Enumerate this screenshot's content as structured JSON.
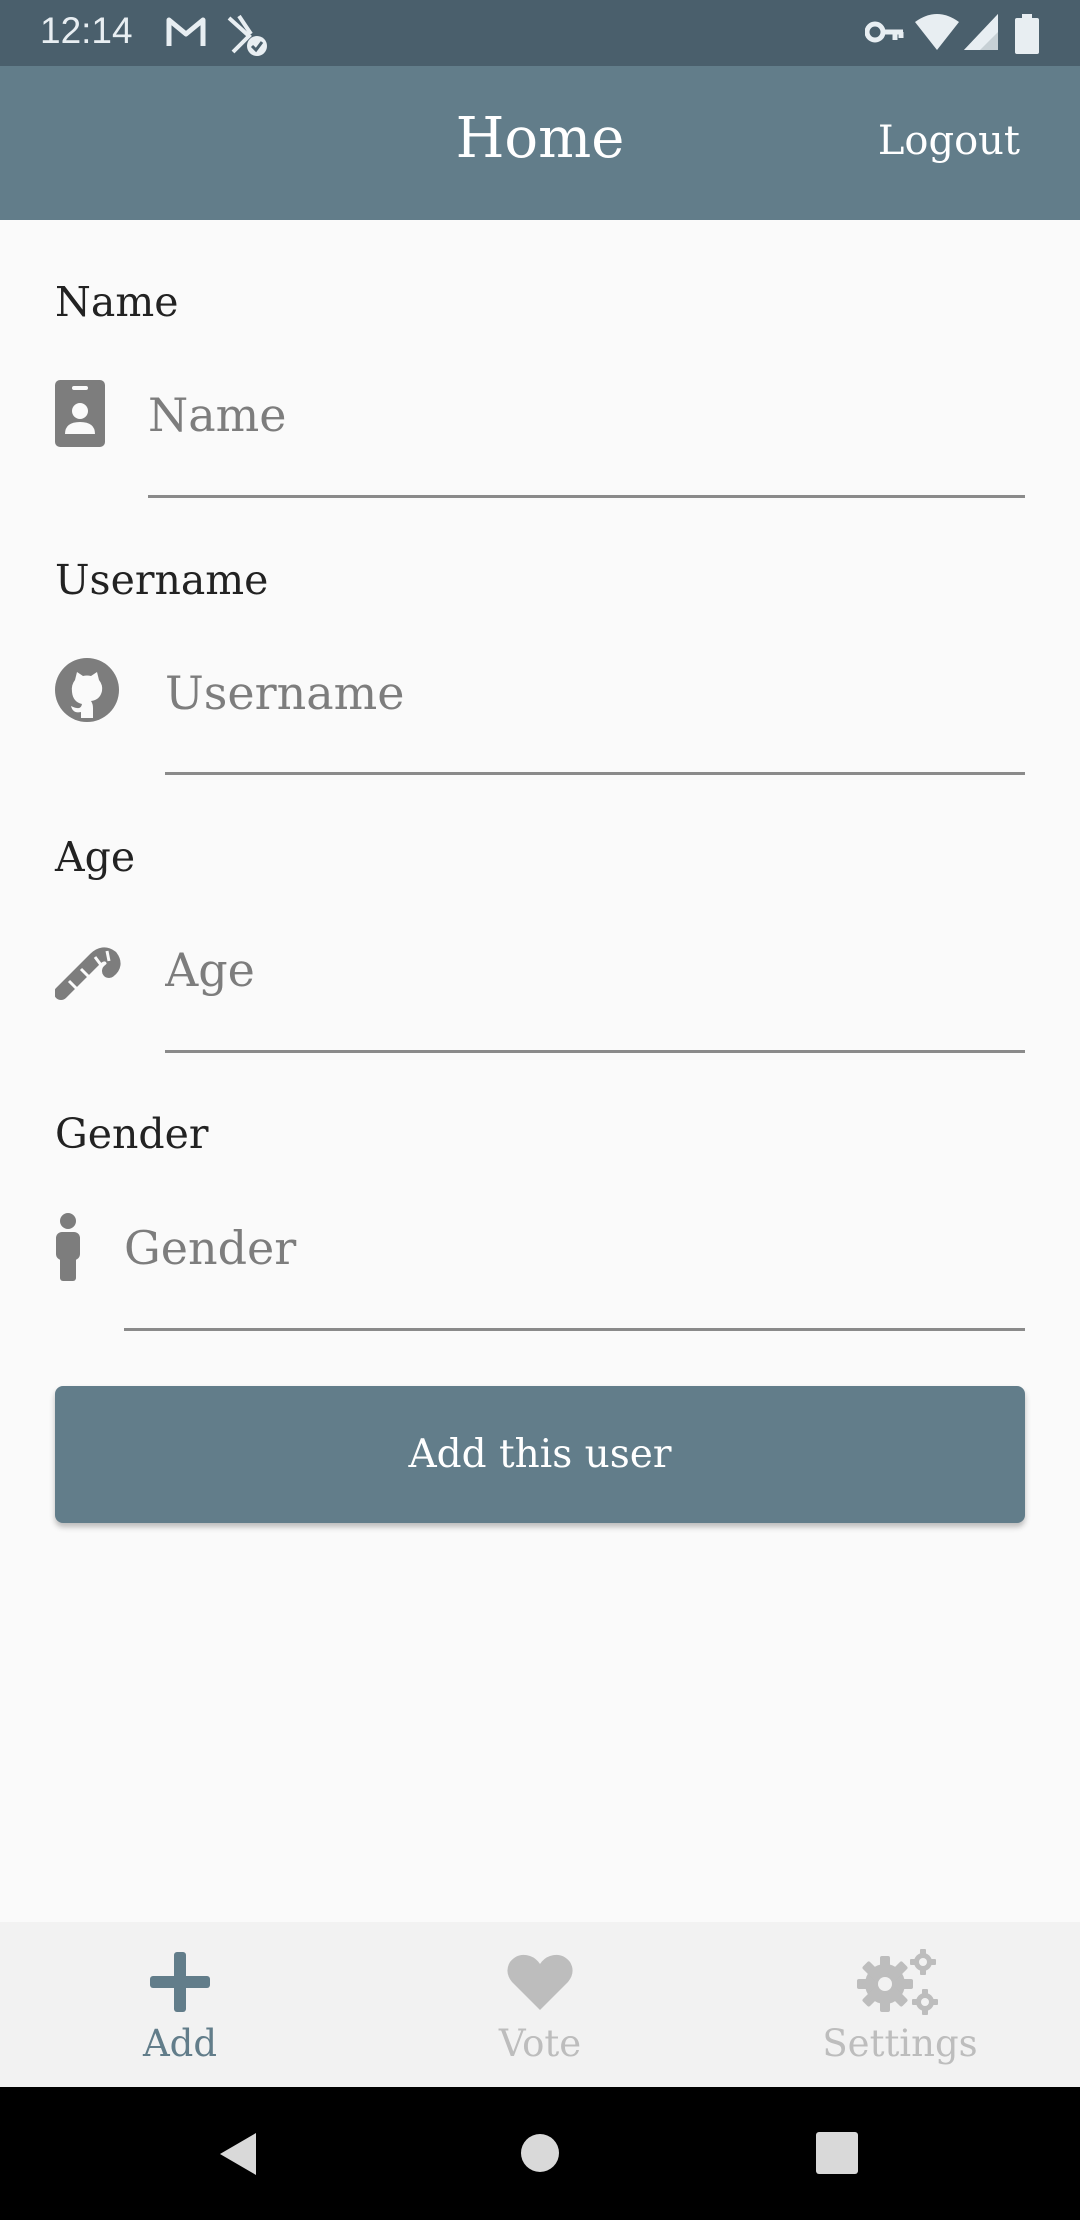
{
  "status_bar": {
    "time": "12:14",
    "icons": [
      "gmail-icon",
      "vpn-check-icon",
      "key-icon",
      "wifi-icon",
      "signal-icon",
      "battery-icon"
    ]
  },
  "app_bar": {
    "title": "Home",
    "logout_label": "Logout"
  },
  "form": {
    "fields": [
      {
        "label": "Name",
        "placeholder": "Name",
        "value": "",
        "icon": "id-badge-icon"
      },
      {
        "label": "Username",
        "placeholder": "Username",
        "value": "",
        "icon": "github-icon"
      },
      {
        "label": "Age",
        "placeholder": "Age",
        "value": "",
        "icon": "candy-cane-icon"
      },
      {
        "label": "Gender",
        "placeholder": "Gender",
        "value": "",
        "icon": "person-icon"
      }
    ],
    "submit_label": "Add this user"
  },
  "bottom_nav": {
    "items": [
      {
        "label": "Add",
        "icon": "plus-icon",
        "active": true
      },
      {
        "label": "Vote",
        "icon": "heart-icon",
        "active": false
      },
      {
        "label": "Settings",
        "icon": "gears-icon",
        "active": false
      }
    ]
  },
  "colors": {
    "primary": "#627d8a",
    "status_bar": "#4a5f6c",
    "inactive": "#bdbdbd",
    "background": "#fafafa"
  }
}
